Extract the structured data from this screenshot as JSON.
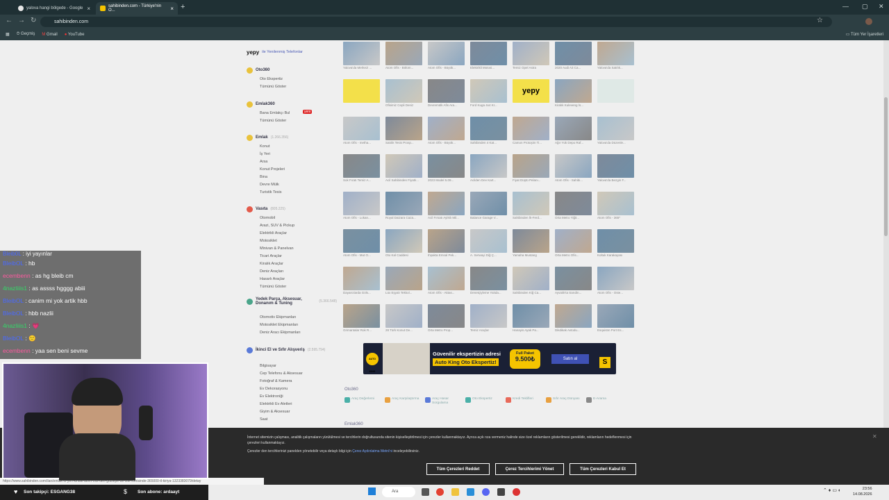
{
  "browser": {
    "tabs": [
      {
        "label": "yalova hangi bölgede - Google"
      },
      {
        "label": "sahibinden.com - Türkiye'nin O..."
      }
    ],
    "url": "sahibinden.com",
    "bookmarks": [
      {
        "label": "Geçmiş"
      },
      {
        "label": "Gmail"
      },
      {
        "label": "YouTube"
      }
    ],
    "all_bookmarks": "Tüm Yer İşaretleri"
  },
  "sidebar": {
    "yepy": "yepy",
    "yepy_text": "ile Yenilenmiş Telefonlar",
    "oto360": {
      "title": "Oto360",
      "items": [
        "Oto Ekspertiz",
        "Tümünü Göster"
      ]
    },
    "emlak360": {
      "title": "Emlak360",
      "items": [
        "Bana Emlakçı Bul",
        "Tümünü Göster"
      ],
      "badge": "yeni"
    },
    "emlak": {
      "title": "Emlak",
      "count": "(1.266.356)",
      "items": [
        "Konut",
        "İş Yeri",
        "Arsa",
        "Konut Projeleri",
        "Bina",
        "Devre Mülk",
        "Turistik Tesis"
      ]
    },
    "vasita": {
      "title": "Vasıta",
      "count": "(805.225)",
      "items": [
        "Otomobil",
        "Arazi, SUV & Pickup",
        "Elektrikli Araçlar",
        "Motosiklet",
        "Minivan & Panelvan",
        "Ticari Araçlar",
        "Kiralık Araçlar",
        "Deniz Araçları",
        "Hasarlı Araçlar",
        "Tümünü Göster"
      ]
    },
    "yedek": {
      "title": "Yedek Parça, Aksesuar, Donanım & Tuning",
      "count": "(5.366.548)",
      "items": [
        "Otomotiv Ekipmanları",
        "Motosiklet Ekipmanları",
        "Deniz Aracı Ekipmanları"
      ]
    },
    "ikinci": {
      "title": "İkinci El ve Sıfır Alışveriş",
      "count": "(2.595.794)",
      "items": [
        "Bilgisayar",
        "Cep Telefonu & Aksesuar",
        "Fotoğraf & Kamera",
        "Ev Dekorasyonu",
        "Ev Elektroniği",
        "Elektrikli Ev Aletleri",
        "Giyim & Aksesuar",
        "Saat"
      ]
    }
  },
  "grid": {
    "rows": [
      [
        "Yalova'da Merkezi ...",
        "Atom Ofis - Bölüm...",
        "Atom Ofis - Büyük...",
        "Elektrikli Motosi...",
        "Temiz Opel Astra",
        "2020 Audi A3 Ca...",
        "Yalova'da Satılık..."
      ],
      [
        "",
        "Ofisimiz Cepli Deniz",
        "Devremülk Afis Ara...",
        "Ford Kuga 4x4 Kr...",
        "yepy",
        "Kiralık Kuleveng İs...",
        ""
      ],
      [
        "Atom Ofis - metha...",
        "Satılık Tesis Prosp...",
        "Atom Ofis - Büyük...",
        "Sahibinden 4 Kat...",
        "Camon Protoşim Ti...",
        "Ağır Yük Depo Raf...",
        "Yalova'da Düzenle..."
      ],
      [
        "Sok Fıratı Temiz A...",
        "Acil Sahibinden Fiyatlı...",
        "2023 Model 5.09...",
        "Acilden Dev Kart...",
        "Fiyat Düştü Pelanı...",
        "Atom Ofis - Sahibi...",
        "Yalova'da Bezgin F..."
      ],
      [
        "Atom Ofis - Lokan...",
        "Royal Daizara Caza...",
        "Acil Fırsatı Aylıklı Mil...",
        "Balance Garage V...",
        "Sahibinden İk-Ferd...",
        "Orta Metro Yiğit...",
        "Atom Ofis - 365*"
      ],
      [
        "Atom Ofis - Mut O...",
        "Oto Kal Caddesi",
        "Ihşakta Emsal Pek...",
        "A. Serwayi Diğ Ç...",
        "Yamaha Mustang",
        "Orta Metro Ofis...",
        "Koltuk Karakayası"
      ],
      [
        "Dayarcılarda Göls...",
        "Lüx Eşyalı Tekkol...",
        "Atom Ofis - Aktas...",
        "Denetçiyleme Yalıda...",
        "Sahibinden Kiğ Ca...",
        "Ayvalık'ta Sarıdin...",
        "Atom Ofis - Oste..."
      ],
      [
        "Grimantalar Rok R...",
        "28 Türk Konut De...",
        "Orta Metro Prop...",
        "Temiz Araçlar",
        "Hanayis Ayak Pa...",
        "Dikdikak Avtodu...",
        "Esquistın Port Es..."
      ]
    ]
  },
  "banner": {
    "badge": "AUTO KING",
    "line1": "Güvenilir ekspertizin adresi",
    "line2": "Auto King Oto Ekspertiz!",
    "pack": "Full Paket",
    "price": "9.500₺",
    "cta": "Satın al",
    "logo": "S"
  },
  "shortcuts": {
    "title": "Oto360",
    "items": [
      "Araç Değerlemi",
      "Araç Karşılaştırma",
      "Araç Hasar Sorgulama",
      "Oto Ekspertiz",
      "Kredi Teklifleri",
      "Sıfır Araç Dünyası",
      "E-Arama"
    ],
    "next": "Emlak360"
  },
  "cookie": {
    "text1": "İnternet sitemizin çalışması, analitik çalışmaların yürütülmesi ve tercihlerin doğrultusunda sitenin kişiselleştirilmesi için çerezler kullanmaktayız. Ayrıca açık rıza vermeniz halinde size özel reklamların gösterilmesi gereklidir, reklamların hedeflenmesi için çerezleri kullanmaktayız.",
    "text2": "Çerezler den tercihlerinizi panelden yönetebilir veya detaylı bilgi için",
    "link": "Çerez Aydınlatma Metni'ni",
    "text3": "inceleyebilirsiniz.",
    "reject": "Tüm Çerezleri Reddet",
    "manage": "Çerez Tercihlerimi Yönet",
    "accept": "Tüm Çerezleri Kabul Et"
  },
  "chat": [
    {
      "user": "Bleib0L",
      "msg": "iyi yayınlar"
    },
    {
      "user": "BleibOL",
      "msg": "hb"
    },
    {
      "user": "ecembenn",
      "msg": "as hg bleib cm",
      "color": "#ff5aa0"
    },
    {
      "user": "4nazliiis1",
      "msg": "as assss hgggg abiii",
      "color": "#34d868"
    },
    {
      "user": "BleibOL",
      "msg": "canim mi yok artik hbb"
    },
    {
      "user": "BleibOL",
      "msg": "hbb nazlii"
    },
    {
      "user": "4nazliiis1",
      "msg": "💗",
      "color": "#34d868"
    },
    {
      "user": "BleibOL",
      "msg": "🙂"
    },
    {
      "user": "ecembenn",
      "msg": "yaa sen beni sevme",
      "color": "#ff5aa0"
    }
  ],
  "overlay": {
    "follower_label": "Son takipçi:",
    "follower": "ESGANG38",
    "sub_label": "Son abone:",
    "sub": "ardaayt"
  },
  "status_url": "https://www.sahibinden.com/ilan/emlak-is-yeri-kiralik-atom-ofis-den-goztepe-de-site-icerisinde-365000-tl-kiriya-1323383079/detay",
  "taskbar": {
    "search": "Ara",
    "time": "23:56",
    "date": "14.08.2026"
  },
  "colors": {
    "brand_blue": "#3f51b5",
    "badge_red": "#d22",
    "banner_yellow": "#f5c400"
  }
}
